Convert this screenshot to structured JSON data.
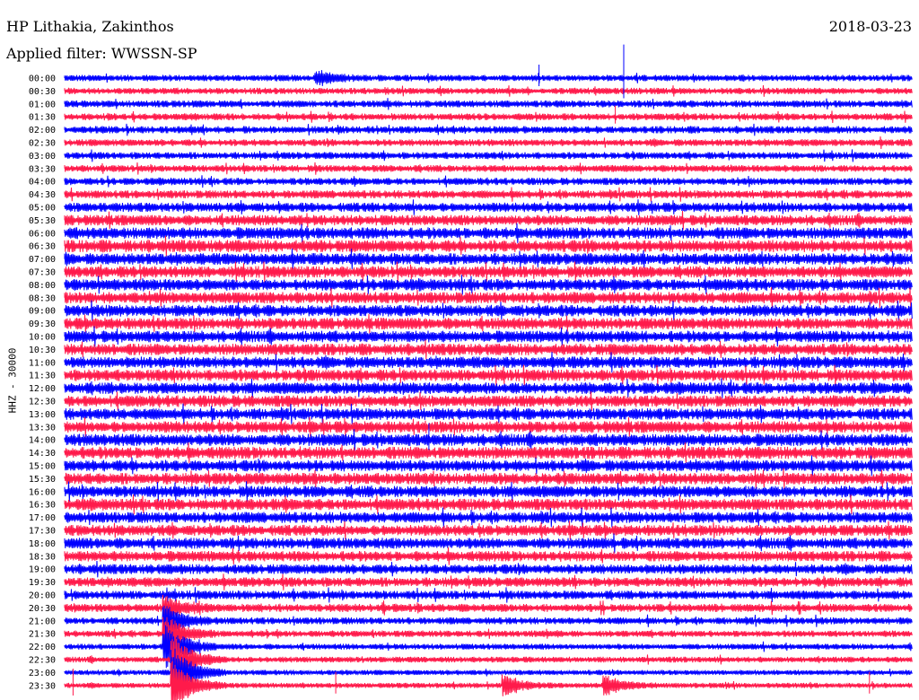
{
  "header": {
    "station": "HP Lithakia, Zakinthos",
    "date": "2018-03-23",
    "filter": "Applied filter: WWSSN-SP",
    "channel_label": "HHZ - 30000"
  },
  "chart_data": {
    "type": "line",
    "title": "HP Lithakia, Zakinthos",
    "subtitle": "Applied filter: WWSSN-SP",
    "ylabel": "HHZ - 30000",
    "xlabel": "",
    "grid": false,
    "legend": "none",
    "row_labels": [
      "00:00",
      "00:30",
      "01:00",
      "01:30",
      "02:00",
      "02:30",
      "03:00",
      "03:30",
      "04:00",
      "04:30",
      "05:00",
      "05:30",
      "06:00",
      "06:30",
      "07:00",
      "07:30",
      "08:00",
      "08:30",
      "09:00",
      "09:30",
      "10:00",
      "10:30",
      "11:00",
      "11:30",
      "12:00",
      "12:30",
      "13:00",
      "13:30",
      "14:00",
      "14:30",
      "15:00",
      "15:30",
      "16:00",
      "16:30",
      "17:00",
      "17:30",
      "18:00",
      "18:30",
      "19:00",
      "19:30",
      "20:00",
      "20:30",
      "21:00",
      "21:30",
      "22:00",
      "22:30",
      "23:00",
      "23:30"
    ],
    "trace_colors": [
      "#0000ff",
      "#ff1a4b"
    ],
    "noise_level": [
      0.55,
      0.55,
      0.6,
      0.6,
      0.62,
      0.6,
      0.6,
      0.6,
      0.62,
      0.7,
      0.8,
      0.9,
      1.0,
      1.05,
      1.0,
      1.0,
      1.0,
      1.0,
      1.0,
      1.0,
      1.0,
      1.0,
      1.0,
      1.0,
      1.0,
      1.0,
      1.0,
      1.0,
      1.05,
      1.05,
      1.0,
      1.0,
      1.0,
      1.0,
      0.95,
      0.95,
      0.95,
      0.9,
      0.85,
      0.8,
      0.75,
      0.7,
      0.6,
      0.55,
      0.5,
      0.5,
      0.45,
      0.45
    ],
    "events": [
      {
        "row": 0,
        "pos": 0.3,
        "amp": 1.2
      },
      {
        "row": 41,
        "pos": 0.12,
        "amp": 2.2
      },
      {
        "row": 42,
        "pos": 0.12,
        "amp": 3.0
      },
      {
        "row": 43,
        "pos": 0.12,
        "amp": 3.8
      },
      {
        "row": 44,
        "pos": 0.12,
        "amp": 4.5
      },
      {
        "row": 45,
        "pos": 0.13,
        "amp": 5.0
      },
      {
        "row": 46,
        "pos": 0.13,
        "amp": 5.0
      },
      {
        "row": 47,
        "pos": 0.13,
        "amp": 5.0
      },
      {
        "row": 47,
        "pos": 0.52,
        "amp": 2.0
      },
      {
        "row": 47,
        "pos": 0.64,
        "amp": 1.8
      }
    ],
    "spikes": [
      {
        "row": 0,
        "pos": 0.66,
        "amp": 3.0
      },
      {
        "row": 0,
        "pos": 0.56,
        "amp": 1.2
      },
      {
        "row": 3,
        "pos": 0.65,
        "amp": 1.0
      },
      {
        "row": 28,
        "pos": 0.43,
        "amp": 1.5
      },
      {
        "row": 47,
        "pos": 0.01,
        "amp": 1.5
      },
      {
        "row": 47,
        "pos": 0.32,
        "amp": 1.2
      },
      {
        "row": 47,
        "pos": 0.95,
        "amp": 1.2
      }
    ]
  }
}
